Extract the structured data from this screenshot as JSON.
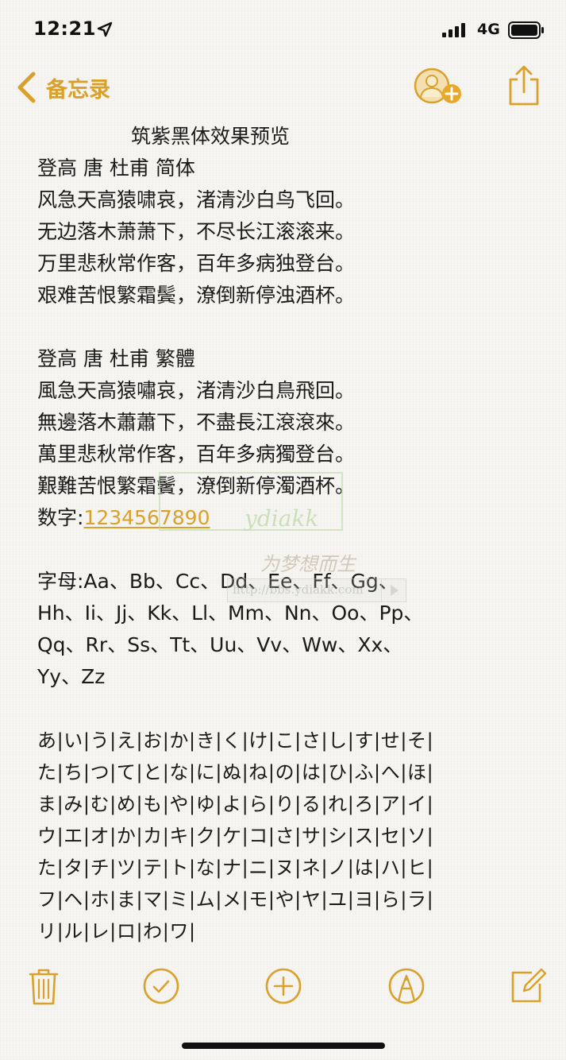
{
  "status_bar": {
    "time": "12:21",
    "network": "4G"
  },
  "nav": {
    "back_label": "备忘录",
    "accent_color": "#d9a12b"
  },
  "note": {
    "title": "筑紫黑体效果预览",
    "simplified_heading": "登高 唐 杜甫 简体",
    "simplified_lines": [
      "风急天高猿啸哀，渚清沙白鸟飞回。",
      "无边落木萧萧下，不尽长江滚滚来。",
      "万里悲秋常作客，百年多病独登台。",
      "艰难苦恨繁霜鬓，潦倒新停浊酒杯。"
    ],
    "traditional_heading": "登高 唐 杜甫 繁體",
    "traditional_lines": [
      "風急天高猿嘯哀，渚清沙白鳥飛回。",
      "無邊落木蕭蕭下，不盡長江滾滾來。",
      "萬里悲秋常作客，百年多病獨登台。",
      "艱難苦恨繁霜鬢，潦倒新停濁酒杯。"
    ],
    "digits_label": "数字:",
    "digits_value": "1234567890",
    "letters_lines": [
      "字母:Aa、Bb、Cc、Dd、Ee、Ff、Gg、",
      "Hh、Ii、Jj、Kk、Ll、Mm、Nn、Oo、Pp、",
      "Qq、Rr、Ss、Tt、Uu、Vv、Ww、Xx、",
      "Yy、Zz"
    ],
    "kana_lines": [
      "あ|い|う|え|お|か|き|く|け|こ|さ|し|す|せ|そ|",
      "た|ち|つ|て|と|な|に|ぬ|ね|の|は|ひ|ふ|へ|ほ|",
      "ま|み|む|め|も|や|ゆ|よ|ら|り|る|れ|ろ|ア|イ|",
      "ウ|エ|オ|か|カ|キ|ク|ケ|コ|さ|サ|シ|ス|セ|ソ|",
      "た|タ|チ|ツ|テ|ト|な|ナ|ニ|ヌ|ネ|ノ|は|ハ|ヒ|",
      "フ|ヘ|ホ|ま|マ|ミ|ム|メ|モ|や|ヤ|ユ|ヨ|ら|ラ|",
      "リ|ル|レ|ロ|わ|ワ|"
    ]
  },
  "watermark": {
    "logo_text": "ydiakk",
    "slogan": "为梦想而生",
    "url": "http://bbs.ydiakk.com"
  },
  "icons": {
    "location": "location-arrow-icon",
    "signal": "cellular-signal-icon",
    "battery": "battery-icon",
    "back": "chevron-left-icon",
    "add_people": "add-people-icon",
    "export": "share-icon",
    "trash": "trash-icon",
    "checklist": "checkmark-circle-icon",
    "add": "plus-circle-icon",
    "markup": "pen-circle-icon",
    "compose": "compose-icon"
  }
}
